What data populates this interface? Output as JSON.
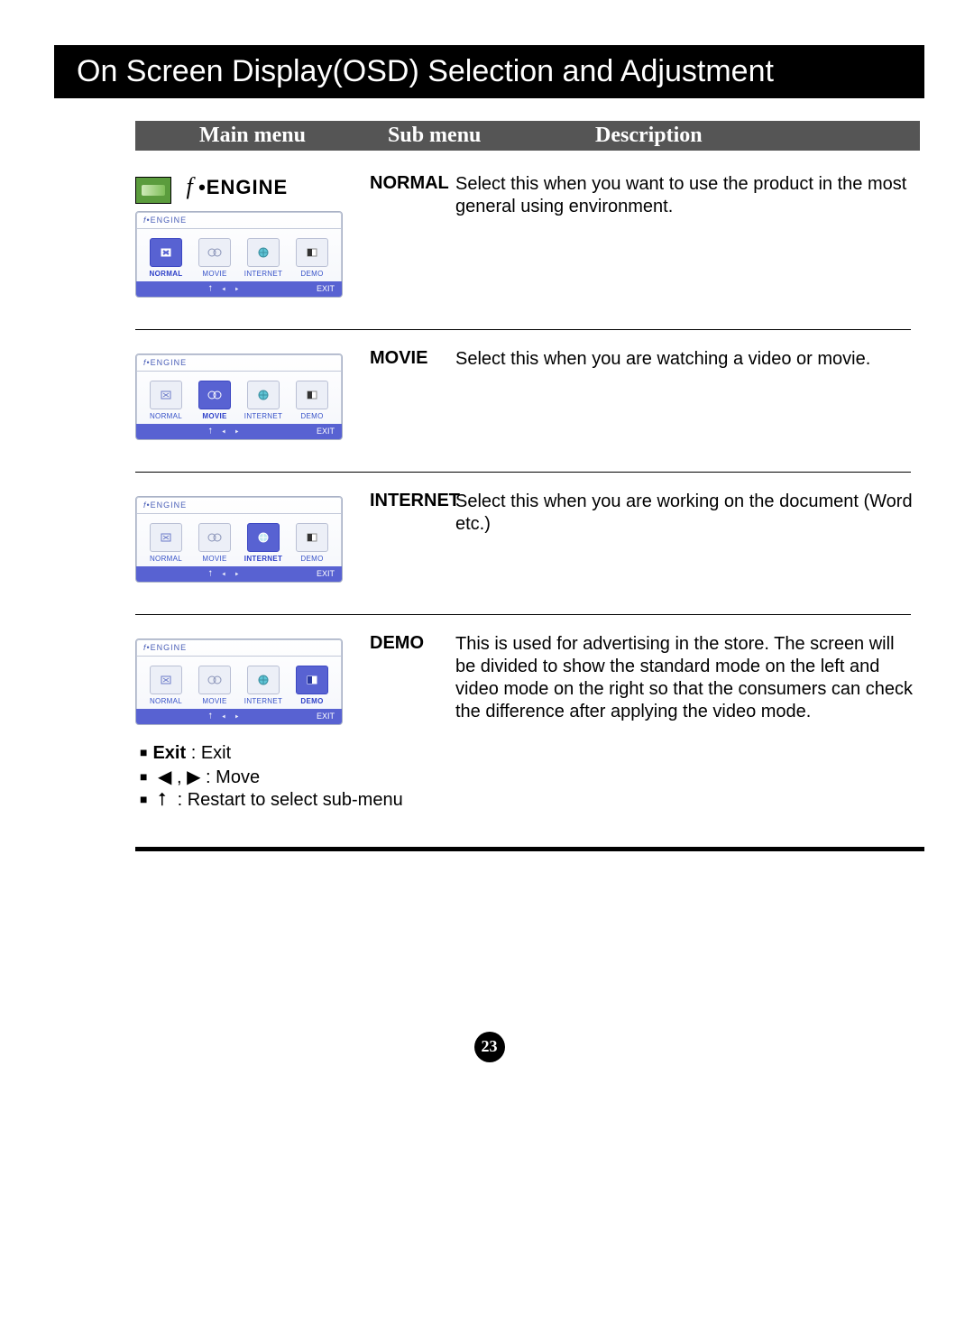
{
  "title": "On Screen Display(OSD) Selection and Adjustment",
  "headers": {
    "main": "Main menu",
    "sub": "Sub menu",
    "desc": "Description"
  },
  "engine_label": "ENGINE",
  "osd_label": "ENGINE",
  "modes": [
    "NORMAL",
    "MOVIE",
    "INTERNET",
    "DEMO"
  ],
  "exit_label": "EXIT",
  "rows": [
    {
      "sub": "NORMAL",
      "desc": "Select this when you want to use the product in the most general using environment."
    },
    {
      "sub": "MOVIE",
      "desc": "Select this when you are watching a video or movie."
    },
    {
      "sub": "INTERNET",
      "desc": "Select this when you are working on the document (Word etc.)"
    },
    {
      "sub": "DEMO",
      "desc": "This is used for advertising in the store. The screen will be divided to show the standard mode on the left and video mode on the right so that the consumers can check the difference after applying the video mode."
    }
  ],
  "notes": {
    "exit_bold": "Exit",
    "exit_text": " : Exit",
    "move_text": " : Move",
    "restart_text": " : Restart to select sub-menu"
  },
  "page_number": "23"
}
